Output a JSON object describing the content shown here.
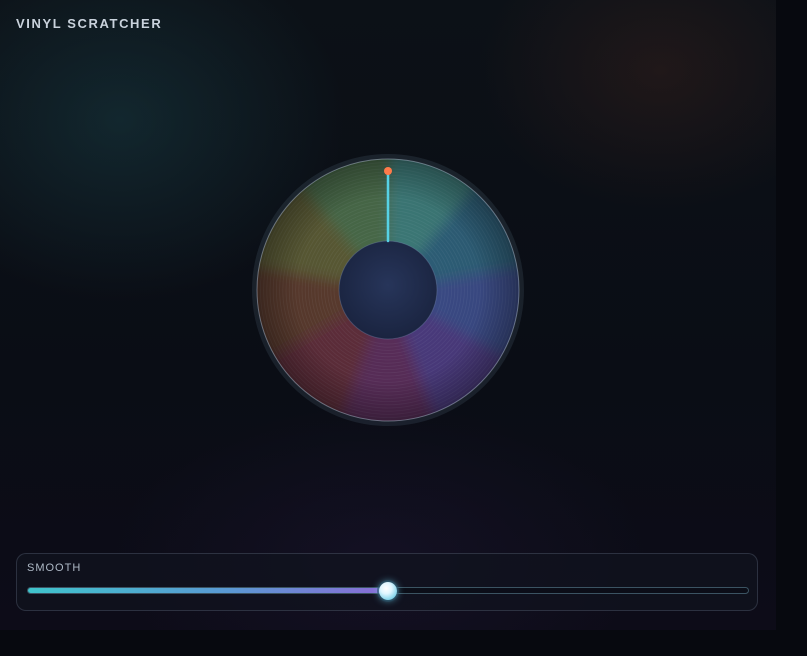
{
  "app": {
    "title": "VINYL SCRATCHER"
  },
  "controls": {
    "smooth": {
      "label": "SMOOTH",
      "value": 0.5
    }
  },
  "record": {
    "segment_colors": [
      "#3e7a78",
      "#2d5f78",
      "#3a4c86",
      "#4b3a7e",
      "#5a2f5a",
      "#5e2e3a",
      "#5a3a2e",
      "#5a5a34",
      "#4a6a48"
    ],
    "label_color": "#1e2a46",
    "needle_tip_color": "#ff7a4a",
    "needle_color": "#56d2e6"
  }
}
